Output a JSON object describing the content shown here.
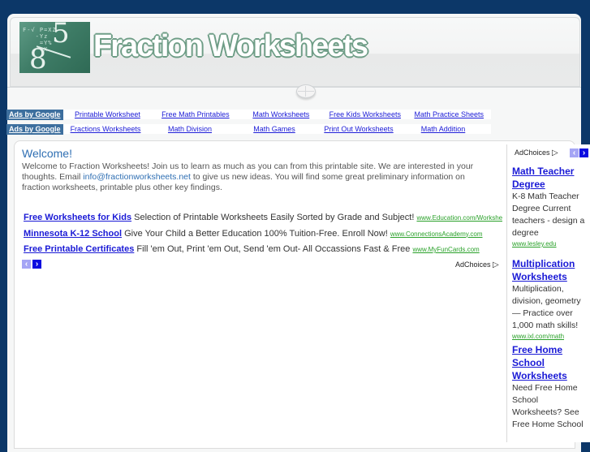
{
  "header": {
    "site_title": "Fraction Worksheets",
    "logo_alt": "fraction-logo",
    "logo_numerator": "5",
    "logo_denominator": "8",
    "logo_scribble": "F-√ P=XZ\n   -Yz\n    =Y%\n    -X"
  },
  "link_units": [
    {
      "badge": "Ads by Google",
      "links": [
        "Printable Worksheet",
        "Free Math Printables",
        "Math Worksheets",
        "Free Kids Worksheets",
        "Math Practice Sheets"
      ]
    },
    {
      "badge": "Ads by Google",
      "links": [
        "Fractions Worksheets",
        "Math Division",
        "Math Games",
        "Print Out Worksheets",
        "Math Addition"
      ]
    }
  ],
  "welcome": {
    "title": "Welcome!",
    "text_before_email": "Welcome to Fraction Worksheets! Join us to learn as much as you can from this printable site. We are interested in your thoughts. Email ",
    "email": "info@fractionworksheets.net",
    "text_after_email": " to give us new ideas. You will find some great preliminary information on fraction worksheets, printable plus other key findings."
  },
  "text_ads": [
    {
      "title": "Free Worksheets for Kids",
      "desc": "Selection of Printable Worksheets Easily Sorted by Grade and Subject!",
      "url": "www.Education.com/Workshee"
    },
    {
      "title": "Minnesota K-12 School",
      "desc": "Give Your Child a Better Education 100% Tuition-Free. Enroll Now!",
      "url": "www.ConnectionsAcademy.com"
    },
    {
      "title": "Free Printable Certificates",
      "desc": "Fill 'em Out, Print 'em Out, Send 'em Out- All Occassions Fast & Free",
      "url": "www.MyFunCards.com"
    }
  ],
  "adchoices": {
    "label": "AdChoices",
    "icon": "▷"
  },
  "arrows": {
    "prev": "‹",
    "next": "›"
  },
  "sidebar_ads": [
    {
      "title": "Math Teacher Degree",
      "desc": "K-8 Math Teacher Degree Current teachers - design a degree",
      "url": "www.lesley.edu"
    },
    {
      "title": "Multiplication Worksheets",
      "desc": "Multiplication, division, geometry— Practice over 1,000 math skills!",
      "url": "www.ixl.com/math"
    },
    {
      "title": "Free Home School Worksheets",
      "desc": "Need Free Home School Worksheets? See Free Home School",
      "url": ""
    }
  ]
}
